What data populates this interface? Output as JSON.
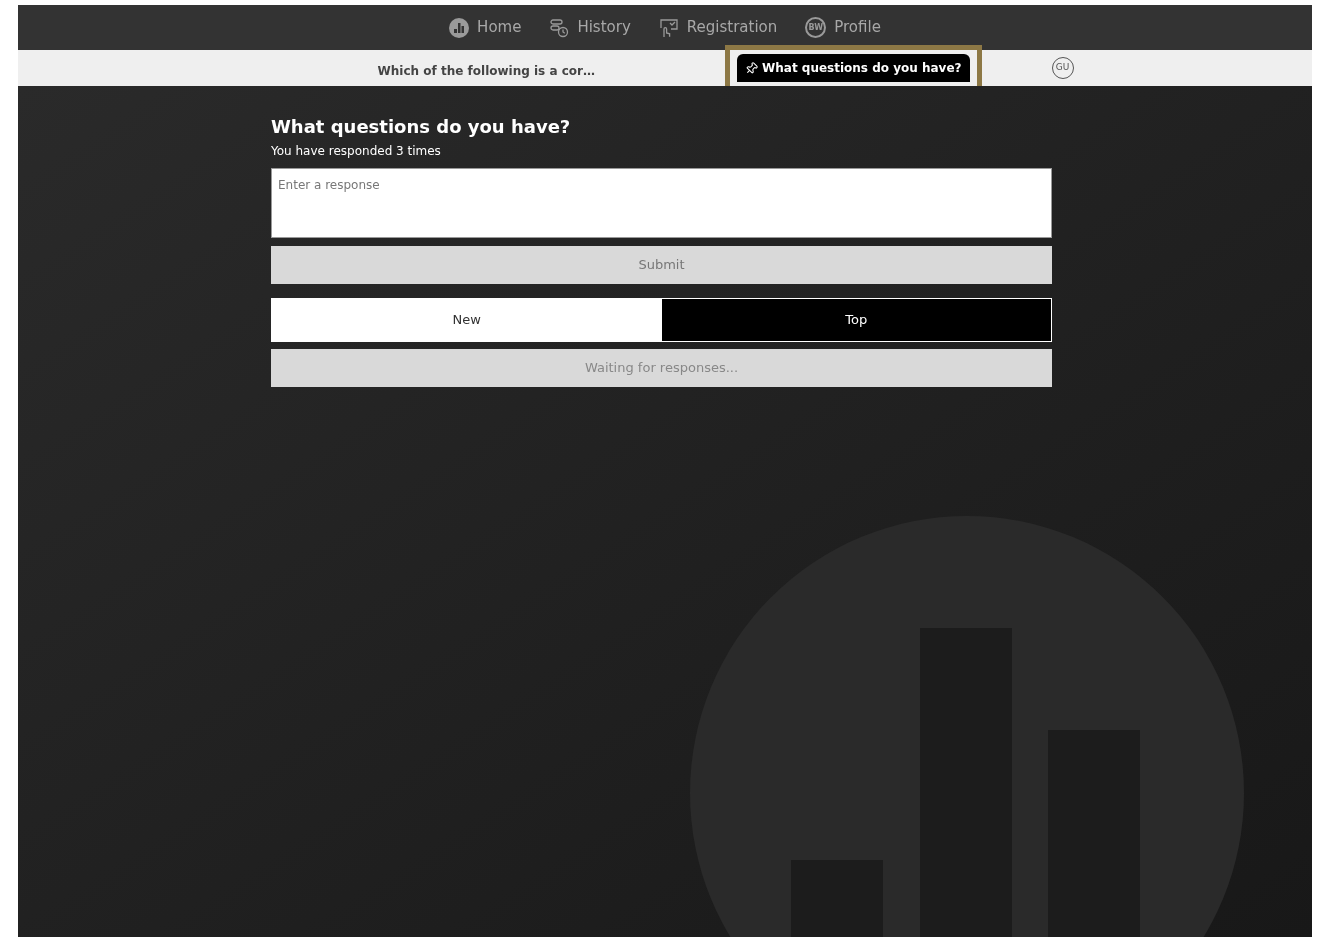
{
  "nav": [
    {
      "kind": "home",
      "label": "Home"
    },
    {
      "kind": "history",
      "label": "History"
    },
    {
      "kind": "registration",
      "label": "Registration"
    },
    {
      "kind": "profile",
      "label": "Profile",
      "initials": "BW"
    }
  ],
  "question_tabs": [
    {
      "label": "Which of the following is a cor…",
      "selected": false,
      "pinned": false
    },
    {
      "label": "What questions do you have?",
      "selected": true,
      "pinned": true
    }
  ],
  "user_badge": "GU",
  "title": "What questions do you have?",
  "response_count": "You have responded 3 times",
  "response_field": {
    "placeholder": "Enter a response"
  },
  "submit_button": "Submit",
  "sort_tabs": [
    {
      "label": "New",
      "selected": false
    },
    {
      "label": "Top",
      "selected": true
    }
  ],
  "status": "Waiting for responses..."
}
